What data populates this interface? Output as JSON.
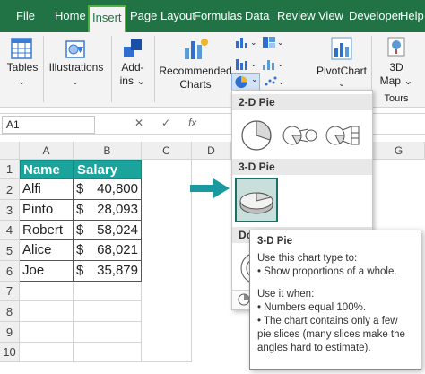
{
  "ribbon_tabs": [
    "File",
    "Home",
    "Insert",
    "Page Layout",
    "Formulas",
    "Data",
    "Review",
    "View",
    "Developer",
    "Help"
  ],
  "ribbon": {
    "tables": "Tables",
    "illustrations": "Illustrations",
    "addins_line1": "Add-",
    "addins_line2": "ins",
    "recommended_line1": "Recommended",
    "recommended_line2": "Charts",
    "pivotchart": "PivotChart",
    "map_line1": "3D",
    "map_line2": "Map",
    "tours": "Tours"
  },
  "formula_bar": {
    "name_box": "A1",
    "cancel": "✕",
    "enter": "✓",
    "fx": "fx"
  },
  "columns": [
    "A",
    "B",
    "C",
    "D",
    "G"
  ],
  "rows": [
    "1",
    "2",
    "3",
    "4",
    "5",
    "6",
    "7",
    "8",
    "9",
    "10"
  ],
  "table": {
    "headers": [
      "Name",
      "Salary"
    ],
    "rows": [
      {
        "name": "Alfi",
        "currency": "$",
        "amount": "40,800"
      },
      {
        "name": "Pinto",
        "currency": "$",
        "amount": "28,093"
      },
      {
        "name": "Robert",
        "currency": "$",
        "amount": "58,024"
      },
      {
        "name": "Alice",
        "currency": "$",
        "amount": "68,021"
      },
      {
        "name": "Joe",
        "currency": "$",
        "amount": "35,879"
      }
    ]
  },
  "dropdown": {
    "section_2d": "2-D Pie",
    "section_3d": "3-D Pie",
    "section_doughnut_partial": "Do"
  },
  "tooltip": {
    "title": "3-D Pie",
    "line1": "Use this chart type to:",
    "line2": "• Show proportions of a whole.",
    "line3": "Use it when:",
    "line4": "• Numbers equal 100%.",
    "line5": "• The chart contains only a few pie slices (many slices make the angles hard to estimate)."
  },
  "colors": {
    "excel_green": "#217346",
    "header_teal": "#1aa49c",
    "arrow_teal": "#1a9aa0",
    "selected_border": "#1e6f66"
  }
}
